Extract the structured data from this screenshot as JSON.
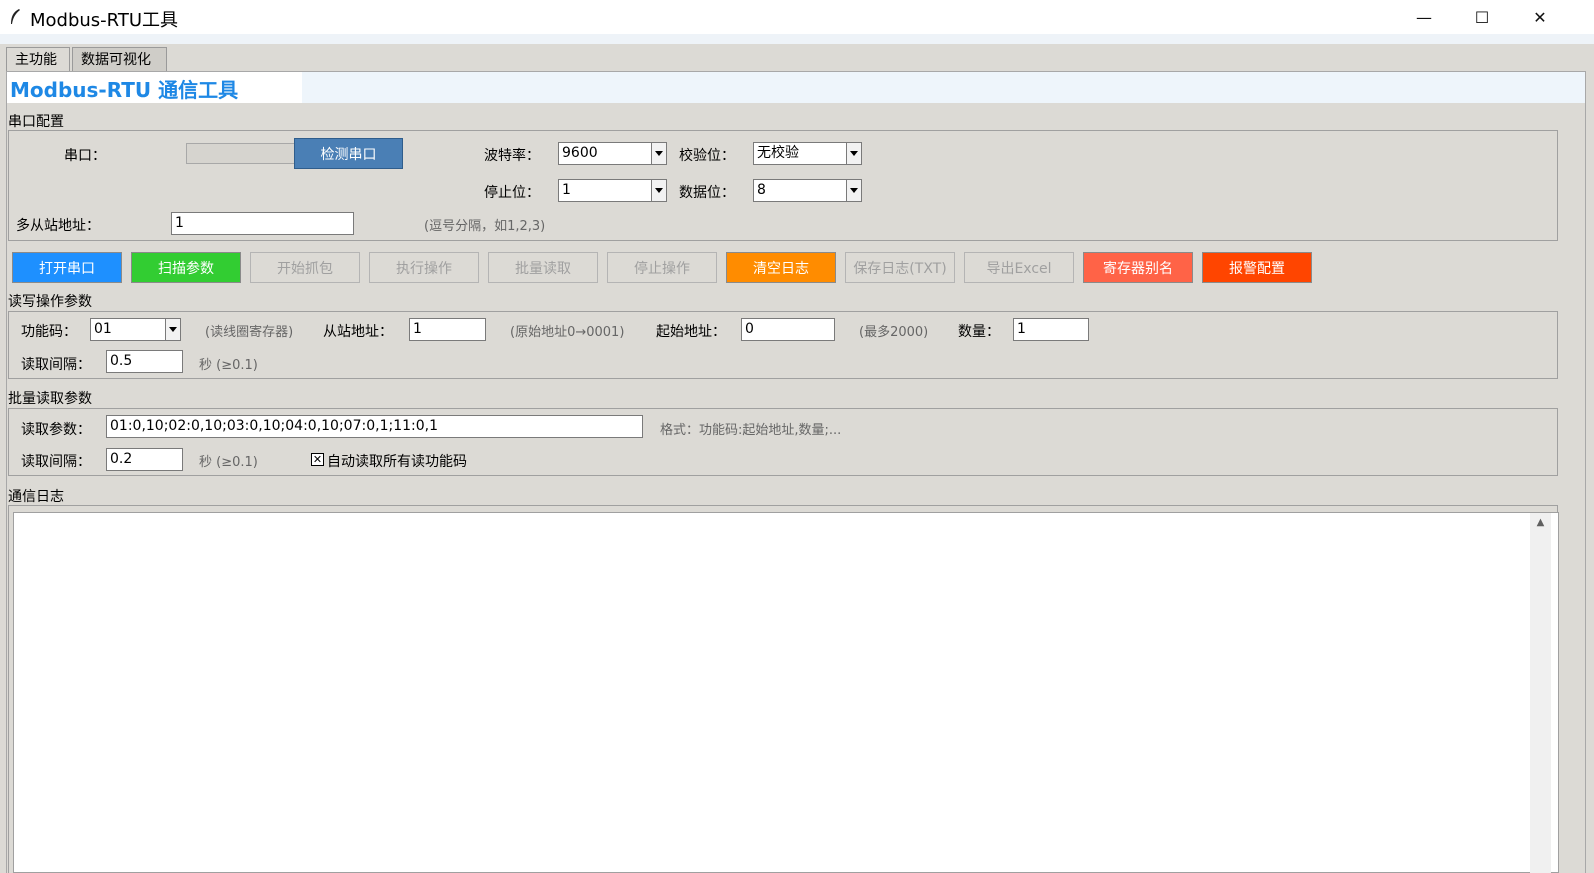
{
  "window": {
    "title": "Modbus-RTU工具",
    "minimize": "—",
    "maximize": "☐",
    "close": "✕"
  },
  "tabs": [
    "主功能",
    "数据可视化"
  ],
  "heading": "Modbus-RTU 通信工具",
  "serial_config": {
    "section": "串口配置",
    "port_label": "串口：",
    "port_value": "",
    "detect_button": "检测串口",
    "baud_label": "波特率：",
    "baud_value": "9600",
    "parity_label": "校验位：",
    "parity_value": "无校验",
    "stopbits_label": "停止位：",
    "stopbits_value": "1",
    "databits_label": "数据位：",
    "databits_value": "8",
    "slaves_label": "多从站地址：",
    "slaves_value": "1",
    "slaves_hint": "(逗号分隔，如1,2,3)"
  },
  "buttons": [
    {
      "label": "打开串口",
      "bg": "#1e90ff",
      "fg": "#ffffff",
      "enabled": true
    },
    {
      "label": "扫描参数",
      "bg": "#32cd32",
      "fg": "#ffffff",
      "enabled": true
    },
    {
      "label": "开始抓包",
      "enabled": false
    },
    {
      "label": "执行操作",
      "enabled": false
    },
    {
      "label": "批量读取",
      "enabled": false
    },
    {
      "label": "停止操作",
      "enabled": false
    },
    {
      "label": "清空日志",
      "bg": "#ff8c00",
      "fg": "#ffffff",
      "enabled": true
    },
    {
      "label": "保存日志(TXT)",
      "enabled": false
    },
    {
      "label": "导出Excel",
      "enabled": false
    },
    {
      "label": "寄存器别名",
      "bg": "#ff6347",
      "fg": "#ffffff",
      "enabled": true
    },
    {
      "label": "报警配置",
      "bg": "#ff4500",
      "fg": "#ffffff",
      "enabled": true
    }
  ],
  "rw_params": {
    "section": "读写操作参数",
    "func_label": "功能码：",
    "func_value": "01",
    "func_hint": "(读线圈寄存器)",
    "slave_label": "从站地址：",
    "slave_value": "1",
    "slave_hint": "(原始地址0→0001)",
    "start_label": "起始地址：",
    "start_value": "0",
    "start_hint": "(最多2000)",
    "count_label": "数量：",
    "count_value": "1",
    "interval_label": "读取间隔：",
    "interval_value": "0.5",
    "interval_unit": "秒 (≥0.1)"
  },
  "batch_params": {
    "section": "批量读取参数",
    "params_label": "读取参数：",
    "params_value": "01:0,10;02:0,10;03:0,10;04:0,10;07:0,1;11:0,1",
    "format_hint": "格式：功能码:起始地址,数量;...",
    "interval_label": "读取间隔：",
    "interval_value": "0.2",
    "interval_unit": "秒 (≥0.1)",
    "auto_check_label": "自动读取所有读功能码",
    "auto_check_mark": "✕"
  },
  "log": {
    "section": "通信日志",
    "scroll_up": "▲"
  },
  "colors": {
    "accent": "#1e88e5",
    "detect_button": "#4a7fb5"
  }
}
